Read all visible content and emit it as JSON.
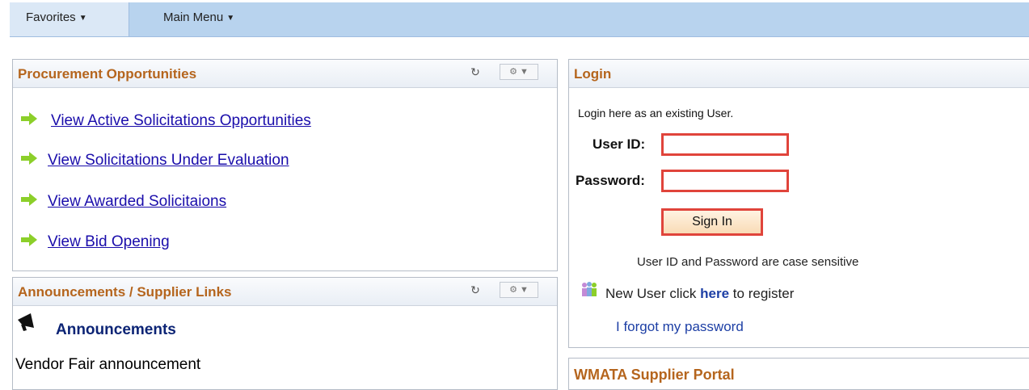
{
  "menubar": {
    "favorites": "Favorites",
    "main_menu": "Main Menu"
  },
  "procurement": {
    "title": "Procurement Opportunities",
    "links": [
      "View Active Solicitations Opportunities",
      "View Solicitations Under Evaluation",
      "View Awarded Solicitaions",
      "View Bid Opening"
    ]
  },
  "announcements": {
    "title": "Announcements / Supplier Links",
    "heading": "Announcements",
    "item": "Vendor Fair announcement"
  },
  "login": {
    "title": "Login",
    "intro": "Login here as an existing User.",
    "user_id_label": "User ID:",
    "user_id_value": "",
    "password_label": "Password:",
    "password_value": "",
    "sign_in": "Sign In",
    "case_note": "User ID and Password are case sensitive",
    "new_user_prefix": "New User click",
    "here": "here",
    "new_user_suffix": "to register",
    "forgot": "I forgot my password"
  },
  "wmata": {
    "title": "WMATA Supplier Portal"
  },
  "colors": {
    "menu_bar": "#b8d3ee",
    "pagelet_title": "#b5651d",
    "link": "#1a0dab",
    "highlight_border": "#e0443b",
    "arrow": "#8ccf2a"
  },
  "icons": {
    "arrow": "green-arrow-icon",
    "refresh": "refresh-icon",
    "settings": "gear-icon",
    "announcement": "megaphone-icon",
    "users": "users-icon"
  }
}
